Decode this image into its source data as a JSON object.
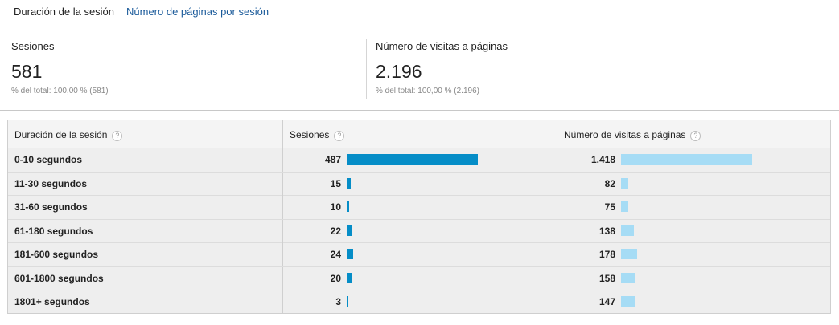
{
  "tabs": {
    "active": "Duración de la sesión",
    "link": "Número de páginas por sesión"
  },
  "summary": {
    "sessions": {
      "label": "Sesiones",
      "value": "581",
      "sub": "% del total: 100,00 % (581)"
    },
    "pageviews": {
      "label": "Número de visitas a páginas",
      "value": "2.196",
      "sub": "% del total: 100,00 % (2.196)"
    }
  },
  "table": {
    "headers": [
      "Duración de la sesión",
      "Sesiones",
      "Número de visitas a páginas"
    ],
    "help_glyph": "?",
    "max_sessions": 487,
    "max_pageviews": 1418,
    "rows": [
      {
        "duration": "0-10 segundos",
        "sessions": "487",
        "sessions_n": 487,
        "pageviews": "1.418",
        "pageviews_n": 1418
      },
      {
        "duration": "11-30 segundos",
        "sessions": "15",
        "sessions_n": 15,
        "pageviews": "82",
        "pageviews_n": 82
      },
      {
        "duration": "31-60 segundos",
        "sessions": "10",
        "sessions_n": 10,
        "pageviews": "75",
        "pageviews_n": 75
      },
      {
        "duration": "61-180 segundos",
        "sessions": "22",
        "sessions_n": 22,
        "pageviews": "138",
        "pageviews_n": 138
      },
      {
        "duration": "181-600 segundos",
        "sessions": "24",
        "sessions_n": 24,
        "pageviews": "178",
        "pageviews_n": 178
      },
      {
        "duration": "601-1800 segundos",
        "sessions": "20",
        "sessions_n": 20,
        "pageviews": "158",
        "pageviews_n": 158
      },
      {
        "duration": "1801+ segundos",
        "sessions": "3",
        "sessions_n": 3,
        "pageviews": "147",
        "pageviews_n": 147
      }
    ]
  },
  "colors": {
    "sessions_bar": "#058dc7",
    "pageviews_bar": "#a6dcf5",
    "link": "#1a5a9a"
  }
}
